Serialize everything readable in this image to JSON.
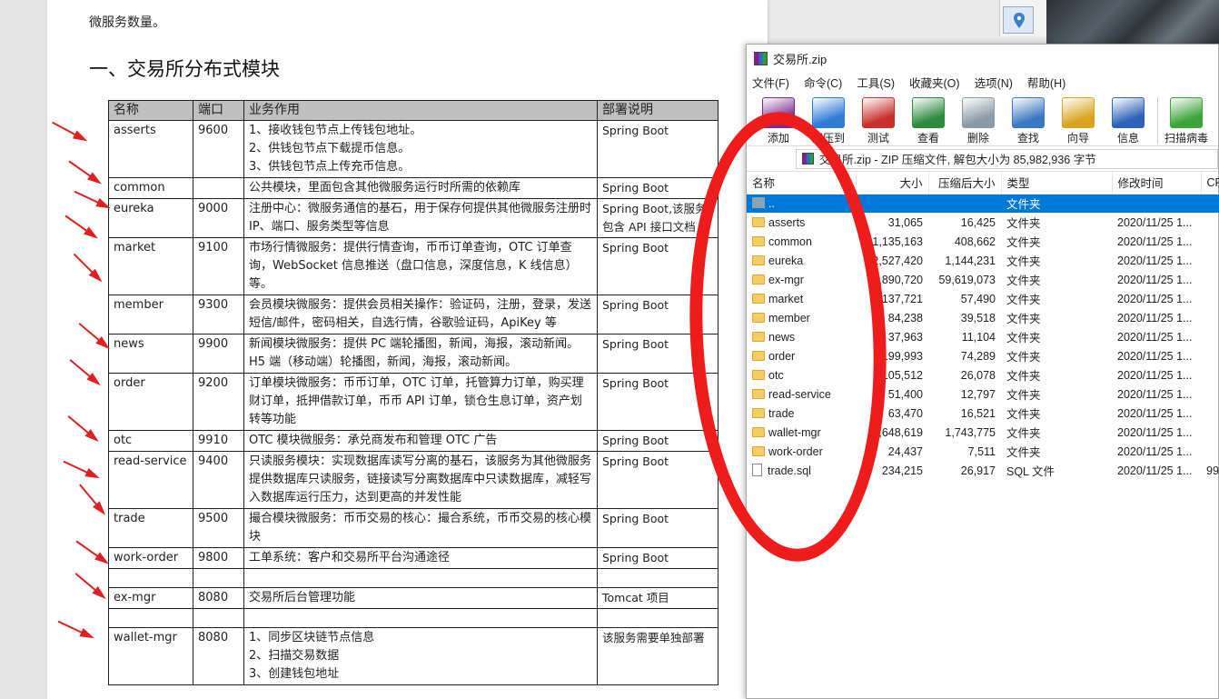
{
  "doc": {
    "intro_text": "微服务数量。",
    "heading": "一、交易所分布式模块",
    "table_headers": [
      "名称",
      "端口",
      "业务作用",
      "部署说明"
    ],
    "rows": [
      {
        "name": "asserts",
        "port": "9600",
        "desc": "1、接收钱包节点上传钱包地址。\n2、供钱包节点下载提币信息。\n3、供钱包节点上传充币信息。",
        "deploy": "Spring Boot"
      },
      {
        "name": "common",
        "port": "",
        "desc": "公共模块，里面包含其他微服务运行时所需的依赖库",
        "deploy": "Spring Boot"
      },
      {
        "name": "eureka",
        "port": "9000",
        "desc": "注册中心：微服务通信的基石，用于保存何提供其他微服务注册时 IP、端口、服务类型等信息",
        "deploy": "Spring Boot,该服务包含 API 接口文档"
      },
      {
        "name": "market",
        "port": "9100",
        "desc": "市场行情微服务：提供行情查询，币币订单查询，OTC 订单查询，WebSocket 信息推送（盘口信息，深度信息，K 线信息）等。",
        "deploy": "Spring Boot"
      },
      {
        "name": "member",
        "port": "9300",
        "desc": "会员模块微服务：提供会员相关操作：验证码，注册，登录，发送短信/邮件，密码相关，自选行情，谷歌验证码，ApiKey 等",
        "deploy": "Spring Boot"
      },
      {
        "name": "news",
        "port": "9900",
        "desc": "新闻模块微服务：提供 PC 端轮播图，新闻，海报，滚动新闻。H5 端（移动端）轮播图，新闻，海报，滚动新闻。",
        "deploy": "Spring Boot"
      },
      {
        "name": "order",
        "port": "9200",
        "desc": "订单模块微服务：币币订单，OTC 订单，托管算力订单，购买理财订单，抵押借款订单，币币 API 订单，锁仓生息订单，资产划转等功能",
        "deploy": "Spring Boot"
      },
      {
        "name": "otc",
        "port": "9910",
        "desc": "OTC 模块微服务：承兑商发布和管理 OTC 广告",
        "deploy": "Spring Boot"
      },
      {
        "name": "read-service",
        "port": "9400",
        "desc": "只读服务模块：实现数据库读写分离的基石，该服务为其他微服务提供数据库只读服务，链接读写分离数据库中只读数据库，减轻写入数据库运行压力，达到更高的并发性能",
        "deploy": "Spring Boot"
      },
      {
        "name": "trade",
        "port": "9500",
        "desc": "撮合模块微服务：币币交易的核心：撮合系统，币币交易的核心模块",
        "deploy": "Spring Boot"
      },
      {
        "name": "work-order",
        "port": "9800",
        "desc": "工单系统：客户和交易所平台沟通途径",
        "deploy": "Spring Boot"
      },
      {
        "name": "",
        "port": "",
        "desc": "",
        "deploy": ""
      },
      {
        "name": "ex-mgr",
        "port": "8080",
        "desc": "交易所后台管理功能",
        "deploy": "Tomcat 项目"
      },
      {
        "name": "",
        "port": "",
        "desc": "",
        "deploy": ""
      },
      {
        "name": "wallet-mgr",
        "port": "8080",
        "desc": "1、同步区块链节点信息\n2、扫描交易数据\n3、创建钱包地址",
        "deploy": "该服务需要单独部署"
      }
    ]
  },
  "rar": {
    "title": "交易所.zip",
    "menu": [
      "文件(F)",
      "命令(C)",
      "工具(S)",
      "收藏夹(O)",
      "选项(N)",
      "帮助(H)"
    ],
    "tools": [
      {
        "label": "添加",
        "icon": "add-icon",
        "color": "#7a2d8f"
      },
      {
        "label": "解压到",
        "icon": "extract-icon",
        "color": "#2f7bd6"
      },
      {
        "label": "测试",
        "icon": "test-icon",
        "color": "#c9302c"
      },
      {
        "label": "查看",
        "icon": "view-icon",
        "color": "#2e8b3e"
      },
      {
        "label": "删除",
        "icon": "delete-icon",
        "color": "#8a9aa6"
      },
      {
        "label": "查找",
        "icon": "find-icon",
        "color": "#3b78c2"
      },
      {
        "label": "向导",
        "icon": "wizard-icon",
        "color": "#d9a520"
      },
      {
        "label": "信息",
        "icon": "info-icon",
        "color": "#2f62b8"
      },
      {
        "label": "扫描病毒",
        "icon": "virus-scan-icon",
        "color": "#3ea33a"
      }
    ],
    "path_text": "交易所.zip - ZIP 压缩文件, 解包大小为 85,982,936 字节",
    "columns": [
      "名称",
      "大小",
      "压缩后大小",
      "类型",
      "修改时间",
      "CF"
    ],
    "files": [
      {
        "name": "..",
        "size": "",
        "packed": "",
        "type": "文件夹",
        "modified": "",
        "crc": "",
        "kind": "up"
      },
      {
        "name": "asserts",
        "size": "31,065",
        "packed": "16,425",
        "type": "文件夹",
        "modified": "2020/11/25 1...",
        "crc": "",
        "kind": "folder"
      },
      {
        "name": "common",
        "size": "1,135,163",
        "packed": "408,662",
        "type": "文件夹",
        "modified": "2020/11/25 1...",
        "crc": "",
        "kind": "folder"
      },
      {
        "name": "eureka",
        "size": "2,527,420",
        "packed": "1,144,231",
        "type": "文件夹",
        "modified": "2020/11/25 1...",
        "crc": "",
        "kind": "folder"
      },
      {
        "name": "ex-mgr",
        "size": "75,890,720",
        "packed": "59,619,073",
        "type": "文件夹",
        "modified": "2020/11/25 1...",
        "crc": "",
        "kind": "folder"
      },
      {
        "name": "market",
        "size": "137,721",
        "packed": "57,490",
        "type": "文件夹",
        "modified": "2020/11/25 1...",
        "crc": "",
        "kind": "folder"
      },
      {
        "name": "member",
        "size": "84,238",
        "packed": "39,518",
        "type": "文件夹",
        "modified": "2020/11/25 1...",
        "crc": "",
        "kind": "folder"
      },
      {
        "name": "news",
        "size": "37,963",
        "packed": "11,104",
        "type": "文件夹",
        "modified": "2020/11/25 1...",
        "crc": "",
        "kind": "folder"
      },
      {
        "name": "order",
        "size": "199,993",
        "packed": "74,289",
        "type": "文件夹",
        "modified": "2020/11/25 1...",
        "crc": "",
        "kind": "folder"
      },
      {
        "name": "otc",
        "size": "105,512",
        "packed": "26,078",
        "type": "文件夹",
        "modified": "2020/11/25 1...",
        "crc": "",
        "kind": "folder"
      },
      {
        "name": "read-service",
        "size": "51,400",
        "packed": "12,797",
        "type": "文件夹",
        "modified": "2020/11/25 1...",
        "crc": "",
        "kind": "folder"
      },
      {
        "name": "trade",
        "size": "63,470",
        "packed": "16,521",
        "type": "文件夹",
        "modified": "2020/11/25 1...",
        "crc": "",
        "kind": "folder"
      },
      {
        "name": "wallet-mgr",
        "size": "3,648,619",
        "packed": "1,743,775",
        "type": "文件夹",
        "modified": "2020/11/25 1...",
        "crc": "",
        "kind": "folder"
      },
      {
        "name": "work-order",
        "size": "24,437",
        "packed": "7,511",
        "type": "文件夹",
        "modified": "2020/11/25 1...",
        "crc": "",
        "kind": "folder"
      },
      {
        "name": "trade.sql",
        "size": "234,215",
        "packed": "26,917",
        "type": "SQL 文件",
        "modified": "2020/11/25 1...",
        "crc": "99",
        "kind": "file"
      }
    ]
  },
  "colors": {
    "annotation_red": "#ee1c1c",
    "selection_blue": "#0078d7",
    "header_gray": "#bfbfbf"
  }
}
